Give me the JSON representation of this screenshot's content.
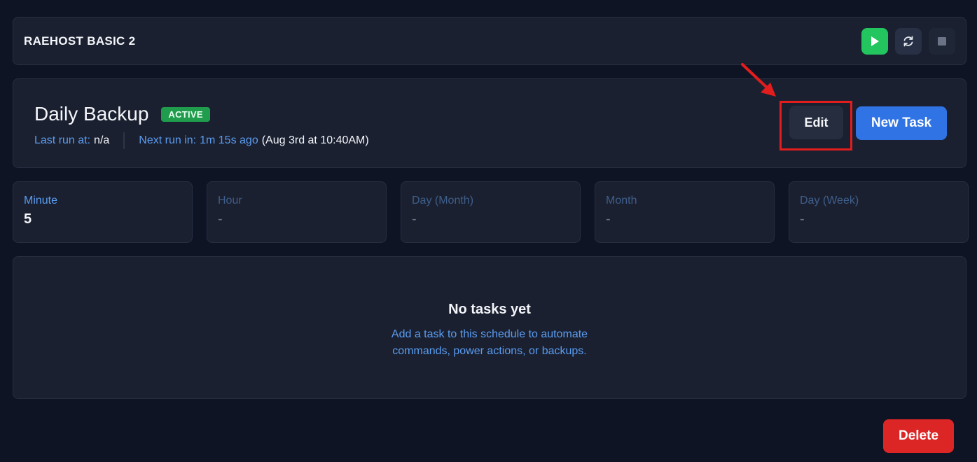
{
  "server": {
    "name": "RAEHOST BASIC 2",
    "power_buttons": [
      {
        "name": "start",
        "icon": "play-icon",
        "color": "#22c55e"
      },
      {
        "name": "restart",
        "icon": "refresh-icon"
      },
      {
        "name": "stop",
        "icon": "stop-icon"
      }
    ]
  },
  "schedule": {
    "title": "Daily Backup",
    "status": "ACTIVE",
    "last_run_label": "Last run at:",
    "last_run_value": "n/a",
    "next_run_label": "Next run in:",
    "next_run_value": "1m 15s ago",
    "next_run_date": "(Aug 3rd at 10:40AM)",
    "edit_label": "Edit",
    "new_task_label": "New Task"
  },
  "cron": [
    {
      "label": "Minute",
      "value": "5"
    },
    {
      "label": "Hour",
      "value": "-"
    },
    {
      "label": "Day (Month)",
      "value": "-"
    },
    {
      "label": "Month",
      "value": "-"
    },
    {
      "label": "Day (Week)",
      "value": "-"
    }
  ],
  "tasks": {
    "empty_title": "No tasks yet",
    "empty_description": "Add a task to this schedule to automate commands, power actions, or backups."
  },
  "delete_label": "Delete",
  "colors": {
    "accent_blue": "#2f73e4",
    "success_green": "#22c55e",
    "danger_red": "#dc2626",
    "highlight_red": "#e11d1d"
  }
}
